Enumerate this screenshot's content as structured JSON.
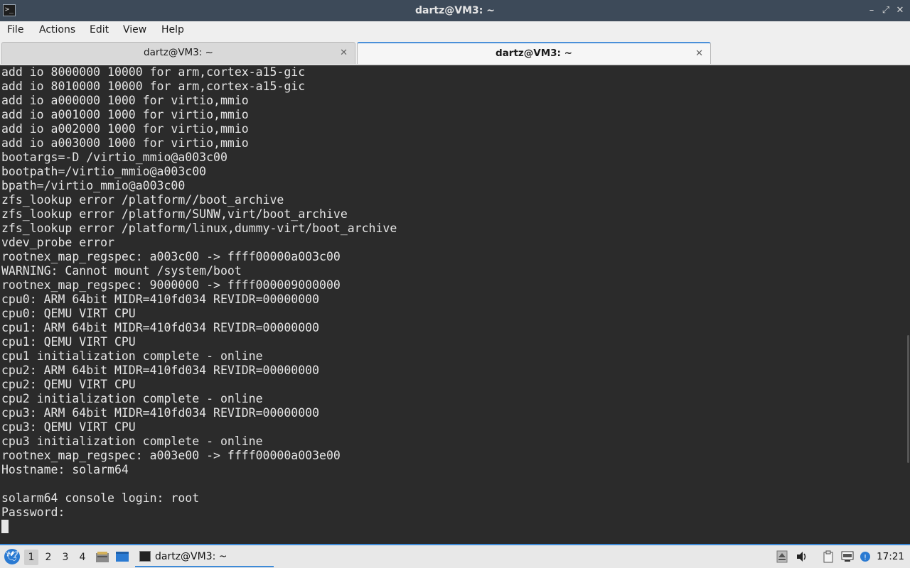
{
  "window": {
    "title": "dartz@VM3: ~",
    "controls": [
      "minimize",
      "maximize",
      "close"
    ]
  },
  "menu": {
    "items": [
      "File",
      "Actions",
      "Edit",
      "View",
      "Help"
    ]
  },
  "tabs": [
    {
      "label": "dartz@VM3: ~",
      "active": false
    },
    {
      "label": "dartz@VM3: ~",
      "active": true
    }
  ],
  "terminal": {
    "lines": [
      "add io 8000000 10000 for arm,cortex-a15-gic",
      "add io 8010000 10000 for arm,cortex-a15-gic",
      "add io a000000 1000 for virtio,mmio",
      "add io a001000 1000 for virtio,mmio",
      "add io a002000 1000 for virtio,mmio",
      "add io a003000 1000 for virtio,mmio",
      "bootargs=-D /virtio_mmio@a003c00",
      "bootpath=/virtio_mmio@a003c00",
      "bpath=/virtio_mmio@a003c00",
      "zfs_lookup error /platform//boot_archive",
      "zfs_lookup error /platform/SUNW,virt/boot_archive",
      "zfs_lookup error /platform/linux,dummy-virt/boot_archive",
      "vdev_probe error",
      "rootnex_map_regspec: a003c00 -> ffff00000a003c00",
      "WARNING: Cannot mount /system/boot",
      "rootnex_map_regspec: 9000000 -> ffff000009000000",
      "cpu0: ARM 64bit MIDR=410fd034 REVIDR=00000000",
      "cpu0: QEMU VIRT CPU",
      "cpu1: ARM 64bit MIDR=410fd034 REVIDR=00000000",
      "cpu1: QEMU VIRT CPU",
      "cpu1 initialization complete - online",
      "cpu2: ARM 64bit MIDR=410fd034 REVIDR=00000000",
      "cpu2: QEMU VIRT CPU",
      "cpu2 initialization complete - online",
      "cpu3: ARM 64bit MIDR=410fd034 REVIDR=00000000",
      "cpu3: QEMU VIRT CPU",
      "cpu3 initialization complete - online",
      "rootnex_map_regspec: a003e00 -> ffff00000a003e00",
      "Hostname: solarm64",
      "",
      "solarm64 console login: root",
      "Password:"
    ]
  },
  "taskbar": {
    "workspaces": [
      "1",
      "2",
      "3",
      "4"
    ],
    "current_workspace": "1",
    "task_label": "dartz@VM3: ~",
    "clock": "17:21",
    "accent": "#3d8ad8"
  },
  "colors": {
    "terminal_bg": "#2b2b2b",
    "terminal_fg": "#e6e6e6",
    "titlebar_bg": "#3d4a59"
  }
}
